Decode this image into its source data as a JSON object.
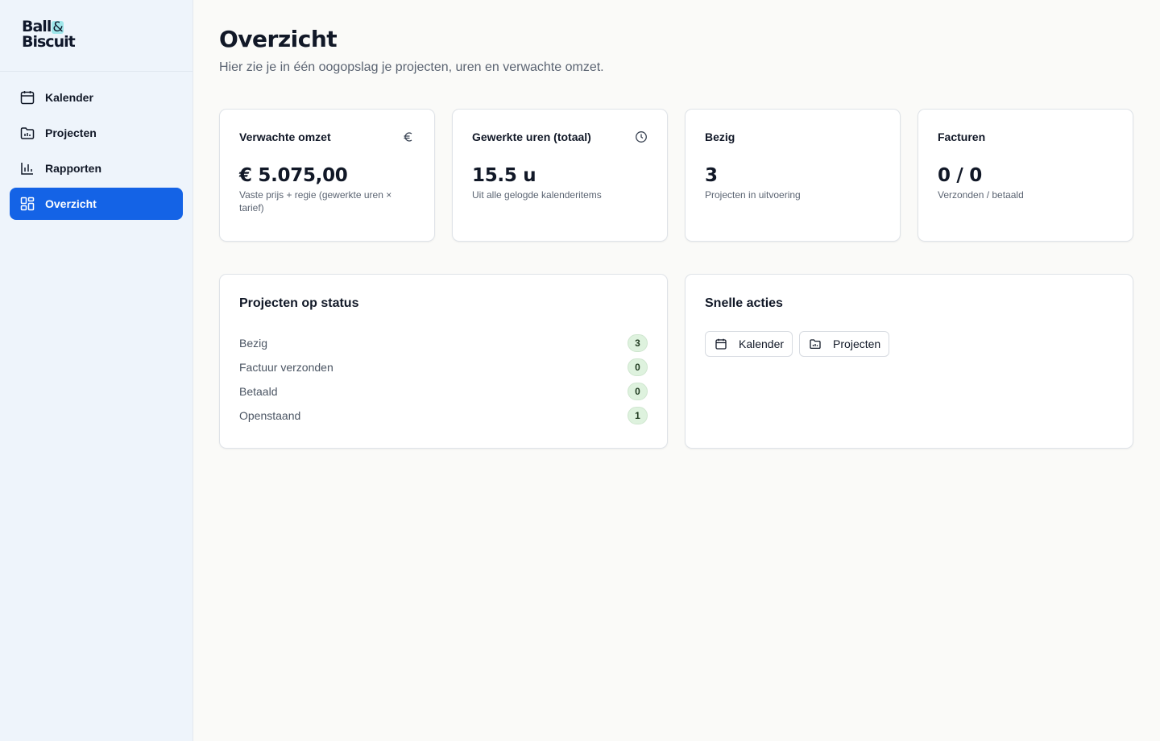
{
  "brand": {
    "line1": "Ball",
    "amp": "&",
    "line2": "Biscuit"
  },
  "sidebar": {
    "items": [
      {
        "label": "Kalender",
        "icon": "calendar-icon",
        "active": false
      },
      {
        "label": "Projecten",
        "icon": "folder-chart-icon",
        "active": false
      },
      {
        "label": "Rapporten",
        "icon": "bar-chart-icon",
        "active": false
      },
      {
        "label": "Overzicht",
        "icon": "dashboard-icon",
        "active": true
      }
    ],
    "accent": "#1463e6"
  },
  "header": {
    "title": "Overzicht",
    "subtitle": "Hier zie je in één oogopslag je projecten, uren en verwachte omzet."
  },
  "stats": [
    {
      "label": "Verwachte omzet",
      "icon": "euro-icon",
      "value": "€ 5.075,00",
      "desc": "Vaste prijs + regie (gewerkte uren × tarief)"
    },
    {
      "label": "Gewerkte uren (totaal)",
      "icon": "clock-icon",
      "value": "15.5 u",
      "desc": "Uit alle gelogde kalenderitems"
    },
    {
      "label": "Bezig",
      "icon": "",
      "value": "3",
      "desc": "Projecten in uitvoering"
    },
    {
      "label": "Facturen",
      "icon": "",
      "value": "0 / 0",
      "desc": "Verzonden / betaald"
    }
  ],
  "status_panel": {
    "title": "Projecten op status",
    "rows": [
      {
        "label": "Bezig",
        "count": "3"
      },
      {
        "label": "Factuur verzonden",
        "count": "0"
      },
      {
        "label": "Betaald",
        "count": "0"
      },
      {
        "label": "Openstaand",
        "count": "1"
      }
    ]
  },
  "actions_panel": {
    "title": "Snelle acties",
    "buttons": [
      {
        "label": "Kalender",
        "icon": "calendar-icon"
      },
      {
        "label": "Projecten",
        "icon": "folder-chart-icon"
      }
    ]
  }
}
